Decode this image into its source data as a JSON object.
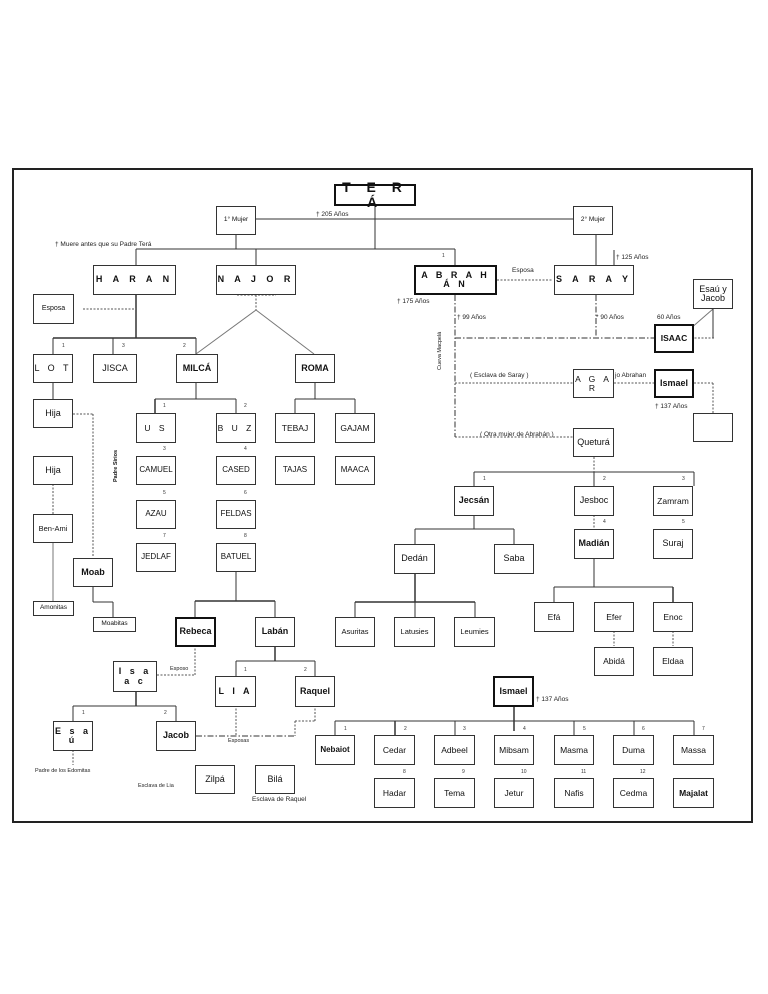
{
  "title": "T E R Á",
  "nodes": {
    "tera": "T E R Á",
    "mujer1": "1° Mujer",
    "mujer2": "2° Mujer",
    "haran": "H A R A N",
    "najor": "N A J O R",
    "abrahan": "A B R A H Á N",
    "saray": "S A R A Y",
    "esposa_haran": "Esposa",
    "esau_jacob": "Esaú y Jacob",
    "isaac_top": "ISAAC",
    "lot": "L O T",
    "jisca": "JISCA",
    "milca": "MILCÁ",
    "roma": "ROMA",
    "agar": "A G A R",
    "ismael_top": "Ismael",
    "empty_box": "",
    "hija1": "Hija",
    "hija2": "Hija",
    "us": "U S",
    "buz": "B U Z",
    "tebaj": "TEBAJ",
    "gajam": "GAJAM",
    "camuel": "CAMUEL",
    "cased": "CASED",
    "tajas": "TAJAS",
    "maaca": "MAACA",
    "azau": "AZAU",
    "feldas": "FELDAS",
    "jedlaf": "JEDLAF",
    "batuel": "BATUEL",
    "ben_ami": "Ben-Ami",
    "moab": "Moab",
    "amonitas": "Amonitas",
    "moabitas": "Moabitas",
    "rebeca": "Rebeca",
    "laban": "Labán",
    "queturah": "Queturá",
    "jecsan": "Jecsán",
    "jesboc": "Jesboc",
    "zamram": "Zamram",
    "madian": "Madián",
    "suraj": "Suraj",
    "dedan": "Dedán",
    "saba": "Saba",
    "asuritas": "Asuritas",
    "latusies": "Latusies",
    "leumies": "Leumies",
    "efa": "Efá",
    "efer": "Efer",
    "enoc": "Enoc",
    "abida": "Abidá",
    "eldaa": "Eldaa",
    "isaac": "I s a a c",
    "lia": "L I A",
    "raquel": "Raquel",
    "esau": "E s a ú",
    "jacob": "Jacob",
    "zilpa": "Zilpá",
    "bila": "Bilá",
    "ismael": "Ismael",
    "nebaiot": "Nebaiot",
    "cedar": "Cedar",
    "adbeel": "Adbeel",
    "mibsam": "Mibsam",
    "masma": "Masma",
    "duma": "Duma",
    "massa": "Massa",
    "hadar": "Hadar",
    "tema": "Tema",
    "jetur": "Jetur",
    "nafis": "Nafis",
    "cedma": "Cedma",
    "majalat": "Majalat"
  },
  "labels": {
    "tera_age": "† 205 Años",
    "haran_note": "† Muere antes que su Padre Terá",
    "saray_age": "† 125 Años",
    "esposa": "Esposa",
    "abrahan_age": "† 175 Años",
    "abrahan_99": "† 99 Años",
    "saray_90": "*  90 Años",
    "isaac_60": "60 Años",
    "cueva": "Cueva Macpelá",
    "esclava_saray": "( Esclava de Saray )",
    "hijo_abrahan": "jo Abrahan",
    "ismael_age_top": "† 137 Años",
    "otra_mujer": "( Otra mujer de Abrahán )",
    "padre_sirios": "Padre Sirios",
    "esposo": "Esposo",
    "esposas": "Esposas",
    "padre_edomitas": "Padre de los Edomitas",
    "esclava_lia": "Esclava de Lia",
    "esclava_raquel": "Esclava de Raquel",
    "ismael_age": "† 137 Años"
  },
  "numbers": {
    "abrahan": "1",
    "lot": "1",
    "jisca": "3",
    "milca": "2",
    "us": "1",
    "buz": "2",
    "camuel": "3",
    "cased": "4",
    "azau": "5",
    "feldas": "6",
    "jedlaf": "7",
    "batuel": "8",
    "jecsan": "1",
    "jesboc": "2",
    "zamram": "3",
    "madian": "4",
    "suraj": "5",
    "lia": "1",
    "raquel": "2",
    "esau": "1",
    "jacob": "2",
    "nebaiot": "1",
    "cedar": "2",
    "adbeel": "3",
    "mibsam": "4",
    "masma": "5",
    "duma": "6",
    "massa": "7",
    "hadar": "8",
    "tema": "9",
    "jetur": "10",
    "nafis": "11",
    "cedma": "12"
  }
}
